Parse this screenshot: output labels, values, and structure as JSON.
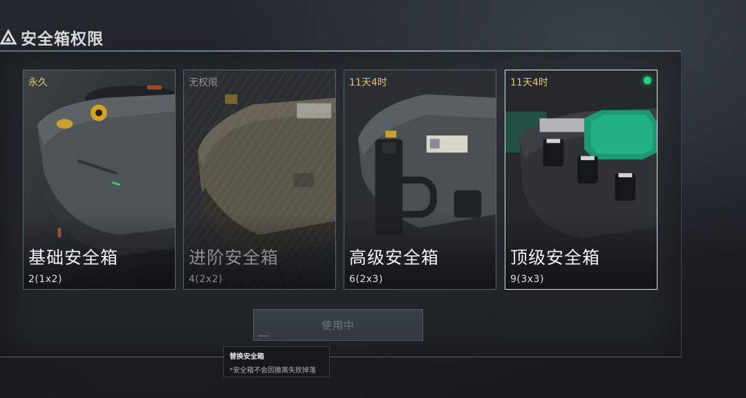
{
  "header": {
    "title": "安全箱权限",
    "icon": "triangle-logo-icon"
  },
  "cards": [
    {
      "tag": "永久",
      "name": "基础安全箱",
      "capacity": "2(1x2)",
      "state": "owned"
    },
    {
      "tag": "无权限",
      "name": "进阶安全箱",
      "capacity": "4(2x2)",
      "state": "locked"
    },
    {
      "tag": "11天4时",
      "name": "高级安全箱",
      "capacity": "6(2x3)",
      "state": "timed"
    },
    {
      "tag": "11天4时",
      "name": "顶级安全箱",
      "capacity": "9(3x3)",
      "state": "selected-active"
    }
  ],
  "action_button": {
    "label": "使用中"
  },
  "tooltip": {
    "title": "替换安全箱",
    "note": "*安全箱不会因撤离失败掉落"
  },
  "colors": {
    "tag_gold": "#e8c46a",
    "active_dot": "#22d37a",
    "selected_border": "#e8eaec",
    "locked_text": "#8a8f94"
  }
}
